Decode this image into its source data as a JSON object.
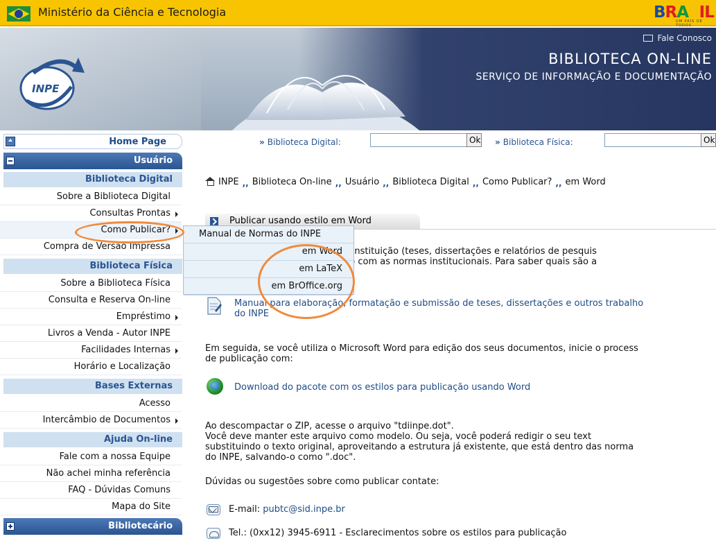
{
  "gov": {
    "title": "Ministério da Ciência e Tecnologia",
    "brand": "BRASIL",
    "brand_sub": "UM PAÍS DE TODOS"
  },
  "banner": {
    "logo_text": "INPE",
    "contact": "Fale Conosco",
    "title": "BIBLIOTECA ON-LINE",
    "subtitle": "SERVIÇO DE INFORMAÇÃO E DOCUMENTAÇÃO"
  },
  "sidebar": {
    "home": "Home Page",
    "user_header": "Usuário",
    "sections": {
      "digital": "Biblioteca Digital",
      "physical": "Biblioteca Física",
      "external": "Bases Externas",
      "help": "Ajuda On-line"
    },
    "digital_items": [
      "Sobre a Biblioteca Digital",
      "Consultas Prontas",
      "Como Publicar?",
      "Compra de Versão Impressa"
    ],
    "physical_items": [
      "Sobre a Biblioteca Física",
      "Consulta e Reserva On-line",
      "Empréstimo",
      "Livros a Venda - Autor INPE",
      "Facilidades Internas",
      "Horário e Localização"
    ],
    "external_items": [
      "Acesso",
      "Intercâmbio de Documentos"
    ],
    "help_items": [
      "Fale com a nossa Equipe",
      "Não achei minha referência",
      "FAQ - Dúvidas Comuns",
      "Mapa do Site"
    ],
    "librarian_header": "Bibliotecário"
  },
  "popup": {
    "items": [
      "Manual de Normas do INPE",
      "em Word",
      "em LaTeX",
      "em BrOffice.org"
    ]
  },
  "search": {
    "digital_label": "Biblioteca Digital:",
    "physical_label": "Biblioteca Física:",
    "digital_value": "",
    "physical_value": "",
    "ok": "Ok"
  },
  "breadcrumb": [
    "INPE",
    "Biblioteca On-line",
    "Usuário",
    "Biblioteca Digital",
    "Como Publicar?",
    "em Word"
  ],
  "tab": {
    "label": "Publicar usando estilo em Word"
  },
  "content": {
    "intro_line1": "Os documentos publicados pela instituição (teses, dissertações e relatórios de pesquis",
    "intro_line2": "devem ser formatados de acordo com as normas institucionais. Para saber quais são a",
    "manual_link_1": "Manual para elaboração, formatação e submissão de teses, dissertações e outros trabalho",
    "manual_link_2": "do INPE",
    "next_1": "Em seguida, se você utiliza o Microsoft Word para edição dos seus documentos, inicie o process",
    "next_2": "de publicação com:",
    "download_link": "Download do pacote com os estilos para publicação usando Word",
    "zip_1": "Ao descompactar o ZIP, acesse o arquivo \"tdiinpe.dot\".",
    "zip_2": "Você deve manter este arquivo como modelo. Ou seja, você poderá redigir o seu text",
    "zip_3": "substituindo o texto original, aproveitando a estrutura já existente, que está dentro das norma",
    "zip_4": "do INPE, salvando-o como \".doc\".",
    "doubts": "Dúvidas ou sugestões sobre como publicar contate:",
    "email_label": "E-mail:",
    "email": "pubtc@sid.inpe.br",
    "tel": "Tel.: (0xx12) 3945-6911 - Esclarecimentos sobre os estilos para publicação"
  },
  "colors": {
    "gov_bar": "#f8c400",
    "sidebar_header": "#2a5592",
    "section_bg": "#cfe0f0",
    "annotation": "#f08a3a",
    "link": "#1e4c87"
  }
}
